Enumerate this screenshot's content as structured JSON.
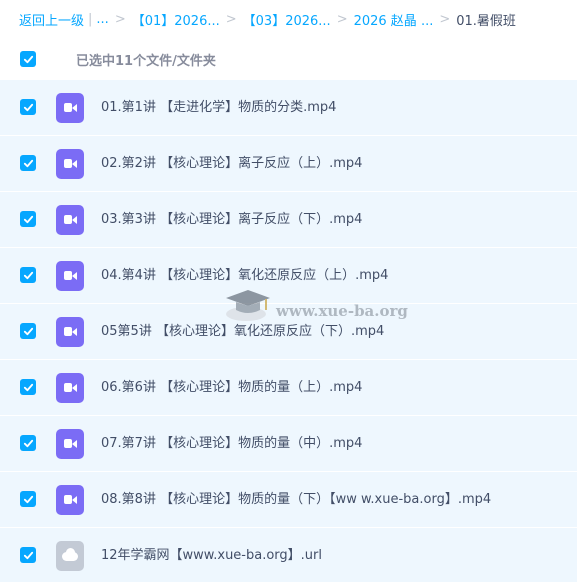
{
  "breadcrumb": {
    "back": "返回上一级",
    "ellipsis": "...",
    "crumb1": "【01】2026...",
    "crumb2": "【03】2026...",
    "crumb3": "2026 赵晶 ...",
    "current": "01.暑假班",
    "separator": ">"
  },
  "selection": {
    "label": "已选中11个文件/文件夹"
  },
  "files": [
    {
      "name": "01.第1讲 【走进化学】物质的分类.mp4",
      "type": "video"
    },
    {
      "name": "02.第2讲 【核心理论】离子反应（上）.mp4",
      "type": "video"
    },
    {
      "name": "03.第3讲 【核心理论】离子反应（下）.mp4",
      "type": "video"
    },
    {
      "name": "04.第4讲 【核心理论】氧化还原反应（上）.mp4",
      "type": "video"
    },
    {
      "name": "05第5讲 【核心理论】氧化还原反应（下）.mp4",
      "type": "video"
    },
    {
      "name": "06.第6讲 【核心理论】物质的量（上）.mp4",
      "type": "video"
    },
    {
      "name": "07.第7讲 【核心理论】物质的量（中）.mp4",
      "type": "video"
    },
    {
      "name": "08.第8讲 【核心理论】物质的量（下）【ww w.xue-ba.org】.mp4",
      "type": "video"
    },
    {
      "name": "12年学霸网【www.xue-ba.org】.url",
      "type": "link"
    }
  ],
  "watermark": {
    "text": "www.xue-ba.org"
  },
  "colors": {
    "accent": "#06a7ff",
    "row_bg": "#eef7fe",
    "video_icon": "#7b6cf5",
    "link_icon": "#c3cad5"
  }
}
